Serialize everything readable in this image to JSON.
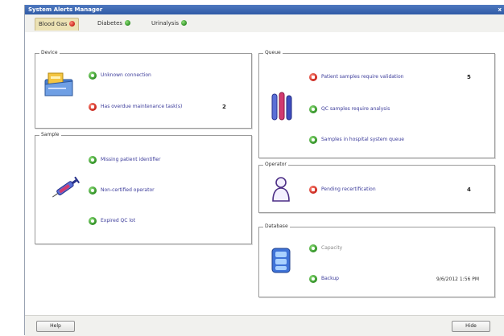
{
  "window": {
    "title": "System Alerts Manager",
    "close_glyph": "x"
  },
  "tabs": [
    {
      "label": "Blood Gas",
      "status": "red",
      "active": true
    },
    {
      "label": "Diabetes",
      "status": "green",
      "active": false
    },
    {
      "label": "Urinalysis",
      "status": "green",
      "active": false
    }
  ],
  "device": {
    "legend": "Device",
    "icon": "device-folder-icon",
    "rows": [
      {
        "label": "Unknown connection",
        "status": "green",
        "count": ""
      },
      {
        "label": "Has overdue maintenance task(s)",
        "status": "red",
        "count": "2"
      }
    ]
  },
  "sample": {
    "legend": "Sample",
    "icon": "syringe-icon",
    "rows": [
      {
        "label": "Missing patient identifier",
        "status": "green"
      },
      {
        "label": "Non-certified operator",
        "status": "green"
      },
      {
        "label": "Expired QC lot",
        "status": "green"
      }
    ]
  },
  "queue": {
    "legend": "Queue",
    "icon": "test-tubes-icon",
    "rows": [
      {
        "label": "Patient samples require validation",
        "status": "red",
        "count": "5"
      },
      {
        "label": "QC samples require analysis",
        "status": "green",
        "count": ""
      },
      {
        "label": "Samples in hospital system queue",
        "status": "green",
        "count": ""
      }
    ]
  },
  "operator": {
    "legend": "Operator",
    "icon": "operator-person-icon",
    "rows": [
      {
        "label": "Pending recertification",
        "status": "red",
        "count": "4"
      }
    ]
  },
  "database": {
    "legend": "Database",
    "icon": "database-icon",
    "rows": [
      {
        "label": "Capacity",
        "status": "green",
        "value": ""
      },
      {
        "label": "Backup",
        "status": "green",
        "value": "9/6/2012 1:56 PM"
      }
    ]
  },
  "footer": {
    "help_label": "Help",
    "hide_label": "Hide"
  },
  "colors": {
    "title_bar": "#3d67b1",
    "active_tab": "#ece2b4",
    "alert_red": "#c8231a",
    "ok_green": "#2f8f24",
    "link_text": "#3b3b9a"
  }
}
